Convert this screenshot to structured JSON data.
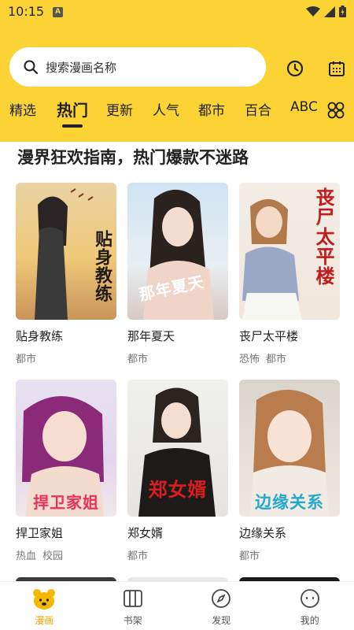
{
  "status": {
    "time": "10:15",
    "indicator": "A"
  },
  "search": {
    "placeholder": "搜索漫画名称"
  },
  "header_icons": [
    "history-clock-icon",
    "calendar-icon"
  ],
  "tabs": [
    {
      "label": "精选",
      "active": false
    },
    {
      "label": "热门",
      "active": true
    },
    {
      "label": "更新",
      "active": false
    },
    {
      "label": "人气",
      "active": false
    },
    {
      "label": "都市",
      "active": false
    },
    {
      "label": "百合",
      "active": false
    },
    {
      "label": "ABC",
      "active": false
    }
  ],
  "section": {
    "title": "漫界狂欢指南，热门爆款不迷路"
  },
  "comics": [
    {
      "title": "贴身教练",
      "tags": [
        "都市"
      ],
      "cover_text": "贴身教练"
    },
    {
      "title": "那年夏天",
      "tags": [
        "都市"
      ],
      "cover_text": "那年夏天"
    },
    {
      "title": "丧尸太平楼",
      "tags": [
        "恐怖",
        "都市"
      ],
      "cover_text": "丧尸太平楼"
    },
    {
      "title": "捍卫家姐",
      "tags": [
        "热血",
        "校园"
      ],
      "cover_text": "捍卫家姐"
    },
    {
      "title": "郑女婿",
      "tags": [
        "都市"
      ],
      "cover_text": "郑女婿"
    },
    {
      "title": "边缘关系",
      "tags": [
        "都市"
      ],
      "cover_text": "边缘关系"
    }
  ],
  "bottom_nav": [
    {
      "label": "漫画",
      "icon": "comic-bear-icon",
      "active": true
    },
    {
      "label": "书架",
      "icon": "bookshelf-icon",
      "active": false
    },
    {
      "label": "发现",
      "icon": "compass-icon",
      "active": false
    },
    {
      "label": "我的",
      "icon": "profile-face-icon",
      "active": false
    }
  ],
  "colors": {
    "accent": "#fbd334",
    "active_nav": "#f0a500"
  }
}
